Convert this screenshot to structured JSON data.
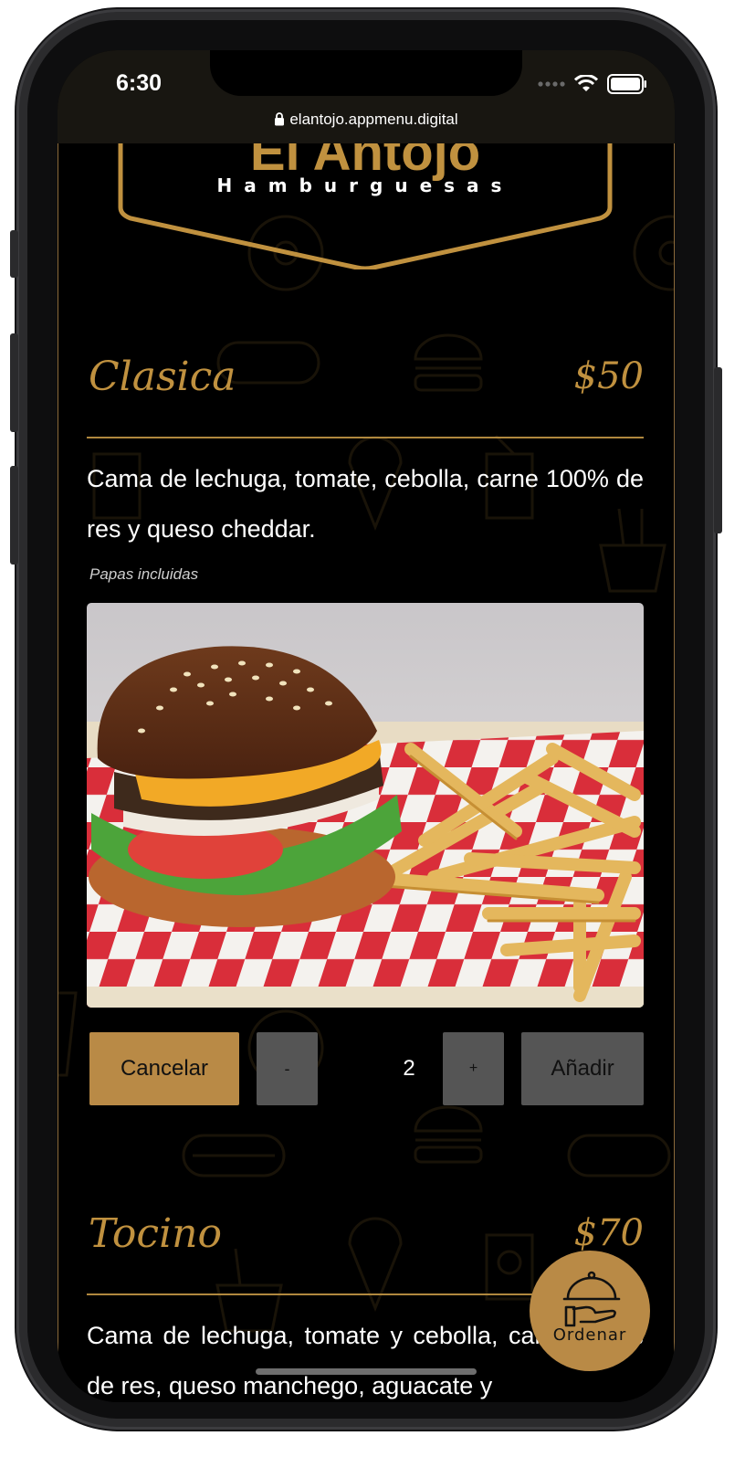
{
  "status_bar": {
    "time": "6:30",
    "url": "elantojo.appmenu.digital",
    "icons": [
      "signal-dots-icon",
      "wifi-icon",
      "battery-icon"
    ]
  },
  "logo": {
    "title": "El Antojo",
    "subtitle": "Hamburguesas"
  },
  "colors": {
    "gold": "#c0913f",
    "button_gold": "#b98a46",
    "button_gray": "#555555",
    "background": "#000000"
  },
  "items": [
    {
      "name": "Clasica",
      "price": "$50",
      "description": "Cama de lechuga, tomate, cebolla, carne 100% de res y queso cheddar.",
      "note": "Papas incluidas",
      "buttons": {
        "cancel": "Cancelar",
        "minus": "-",
        "quantity": "2",
        "plus": "+",
        "add": "Añadir"
      }
    },
    {
      "name": "Tocino",
      "price": "$70",
      "description": "Cama de lechuga, tomate y cebolla, carne 100% de res, queso manchego, aguacate y"
    }
  ],
  "fab": {
    "label": "Ordenar",
    "icon": "serving-cloche-icon"
  }
}
